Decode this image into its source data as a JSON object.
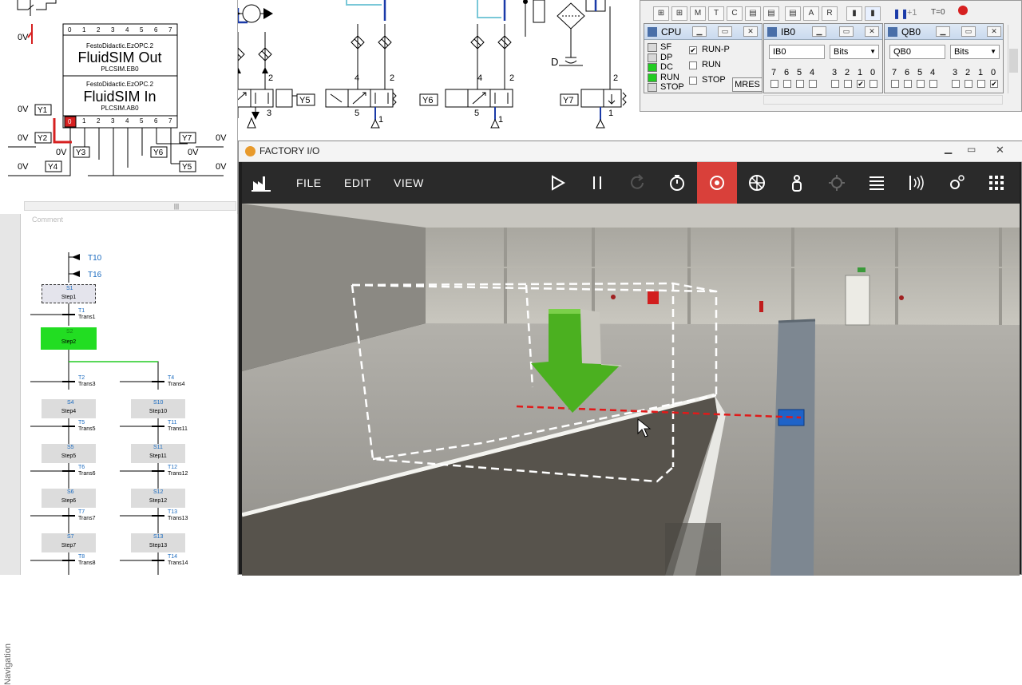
{
  "circuit": {
    "plc_out_label": "FluidSIM Out",
    "plc_out_sub_top": "FestoDidactic.EzOPC.2",
    "plc_out_sub_bottom": "PLCSIM.EB0",
    "plc_in_label": "FluidSIM In",
    "plc_in_sub_top": "FestoDidactic.EzOPC.2",
    "plc_in_sub_bottom": "PLCSIM.AB0",
    "pin_labels": [
      "0",
      "1",
      "2",
      "3",
      "4",
      "5",
      "6",
      "7"
    ],
    "volt": "0V",
    "outputs": [
      "Y1",
      "Y2",
      "Y3",
      "Y4",
      "Y5",
      "Y6",
      "Y7"
    ],
    "port_labels": [
      "4",
      "2",
      "5",
      "3",
      "1"
    ],
    "d_label": "D"
  },
  "grafcet": {
    "comment": "Comment",
    "nav_label": "Navigation",
    "jumps": [
      "T10",
      "T16"
    ],
    "steps_left": [
      {
        "num": "S1",
        "name": "Step1"
      },
      {
        "num": "S2",
        "name": "Step2",
        "active": true
      },
      {
        "num": "S4",
        "name": "Step4"
      },
      {
        "num": "S5",
        "name": "Step5"
      },
      {
        "num": "S6",
        "name": "Step6"
      },
      {
        "num": "S7",
        "name": "Step7"
      }
    ],
    "trans_left": [
      {
        "num": "T1",
        "name": "Trans1"
      },
      {
        "num": "T2",
        "name": "Trans3"
      },
      {
        "num": "T5",
        "name": "Trans5"
      },
      {
        "num": "T6",
        "name": "Trans6"
      },
      {
        "num": "T7",
        "name": "Trans7"
      },
      {
        "num": "T8",
        "name": "Trans8"
      }
    ],
    "steps_right": [
      {
        "num": "S10",
        "name": "Step10"
      },
      {
        "num": "S11",
        "name": "Step11"
      },
      {
        "num": "S12",
        "name": "Step12"
      },
      {
        "num": "S13",
        "name": "Step13"
      }
    ],
    "trans_right": [
      {
        "num": "T4",
        "name": "Trans4"
      },
      {
        "num": "T11",
        "name": "Trans11"
      },
      {
        "num": "T12",
        "name": "Trans12"
      },
      {
        "num": "T13",
        "name": "Trans13"
      },
      {
        "num": "T14",
        "name": "Trans14"
      }
    ]
  },
  "plcsim": {
    "toolbar_t0": "T=0",
    "toolbar_plus1": "+1",
    "cpu": {
      "title": "CPU",
      "leds": [
        "SF",
        "DP",
        "DC",
        "RUN",
        "STOP"
      ],
      "modes": [
        {
          "label": "RUN-P",
          "checked": true
        },
        {
          "label": "RUN",
          "checked": false
        },
        {
          "label": "STOP",
          "checked": false
        }
      ],
      "mres": "MRES"
    },
    "ib0": {
      "title": "IB0",
      "address": "IB0",
      "format": "Bits",
      "bits": [
        "7",
        "6",
        "5",
        "4",
        "3",
        "2",
        "1",
        "0"
      ],
      "checked": [
        false,
        false,
        false,
        false,
        false,
        false,
        true,
        false
      ]
    },
    "qb0": {
      "title": "QB0",
      "address": "QB0",
      "format": "Bits",
      "bits": [
        "7",
        "6",
        "5",
        "4",
        "3",
        "2",
        "1",
        "0"
      ],
      "checked": [
        false,
        false,
        false,
        false,
        false,
        false,
        false,
        true
      ]
    }
  },
  "factoryio": {
    "title": "FACTORY I/O",
    "menu": [
      "FILE",
      "EDIT",
      "VIEW"
    ],
    "toolbar_icons": [
      "play-icon",
      "pause-icon",
      "reset-icon",
      "timer-icon",
      "camera-orbit-icon",
      "fly-camera-icon",
      "first-person-icon",
      "pick-icon",
      "drivers-list-icon",
      "sensor-view-icon",
      "settings-icon",
      "scenes-icon"
    ],
    "active_tool": "camera-orbit-icon",
    "accent": "#d9403a"
  }
}
